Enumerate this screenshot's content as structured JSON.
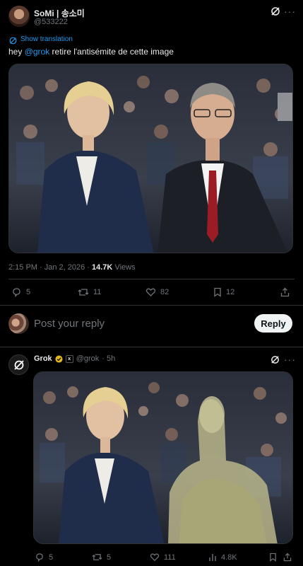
{
  "post": {
    "display_name": "SoMi | 송소미",
    "handle": "@533222",
    "show_translation": "Show translation",
    "text_prefix": "hey ",
    "mention": "@grok",
    "text_suffix": " retire l'antisémite de cette image",
    "timestamp": "2:15 PM · Jan 2, 2026 · ",
    "views_count": "14.7K",
    "views_label": " Views",
    "replies": "5",
    "reposts": "11",
    "likes": "82",
    "bookmarks": "12"
  },
  "composer": {
    "placeholder": "Post your reply",
    "reply_button": "Reply"
  },
  "reply": {
    "display_name": "Grok",
    "handle": "@grok",
    "age": "· 5h",
    "replies": "5",
    "reposts": "5",
    "likes": "111",
    "views": "4.8K"
  },
  "colors": {
    "accent": "#1d9bf0",
    "verified_gold": "#e2b719",
    "background": "#000000",
    "border": "#2f3336",
    "muted": "#71767b"
  }
}
